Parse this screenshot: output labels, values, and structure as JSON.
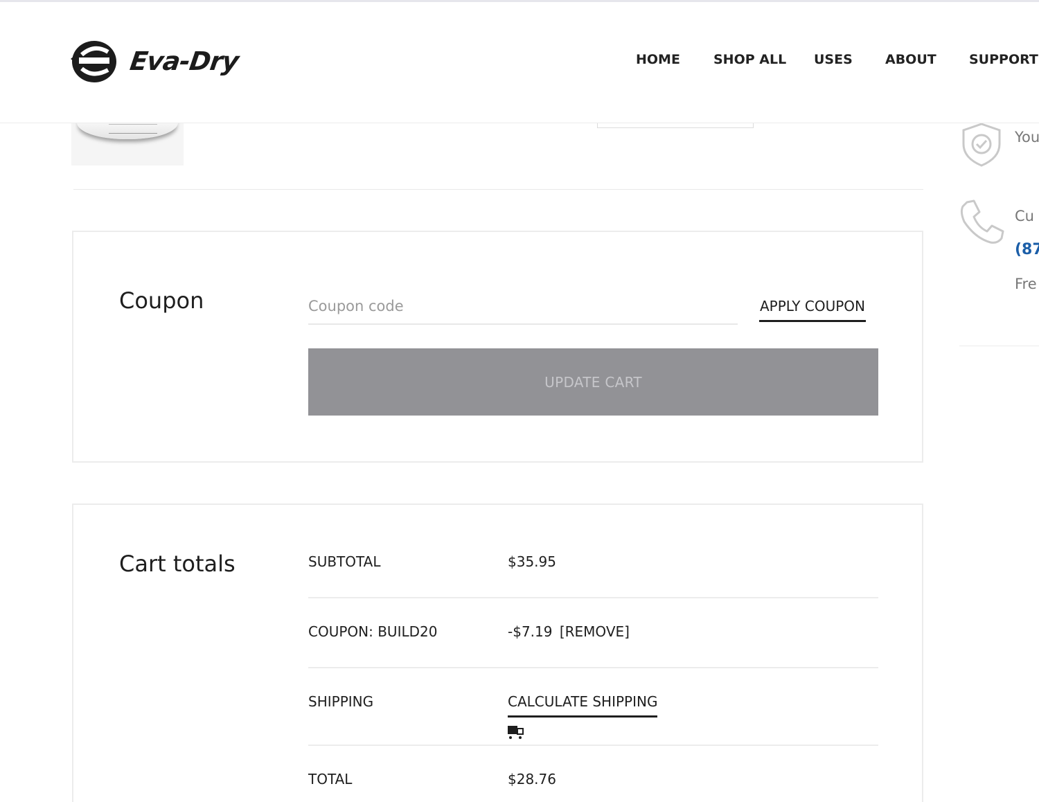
{
  "header": {
    "brand": "Eva-Dry",
    "nav": [
      "HOME",
      "SHOP ALL",
      "USES",
      "ABOUT",
      "SUPPORT"
    ]
  },
  "sidebar": {
    "line1": "You",
    "line2": "Cu",
    "phone": "(87",
    "line4": "Fre"
  },
  "coupon": {
    "title": "Coupon",
    "placeholder": "Coupon code",
    "apply_label": "APPLY COUPON",
    "update_label": "UPDATE CART"
  },
  "totals": {
    "title": "Cart totals",
    "subtotal_label": "SUBTOTAL",
    "subtotal_value": "$35.95",
    "coupon_label": "COUPON: BUILD20",
    "coupon_value": "-$7.19",
    "remove_label": "[REMOVE]",
    "shipping_label": "SHIPPING",
    "shipping_link": "CALCULATE SHIPPING",
    "total_label": "TOTAL",
    "total_value": "$28.76"
  },
  "colors": {
    "accent": "#1e1e1e",
    "disabled_button": "#929296",
    "phone_link": "#1b5ea8"
  }
}
